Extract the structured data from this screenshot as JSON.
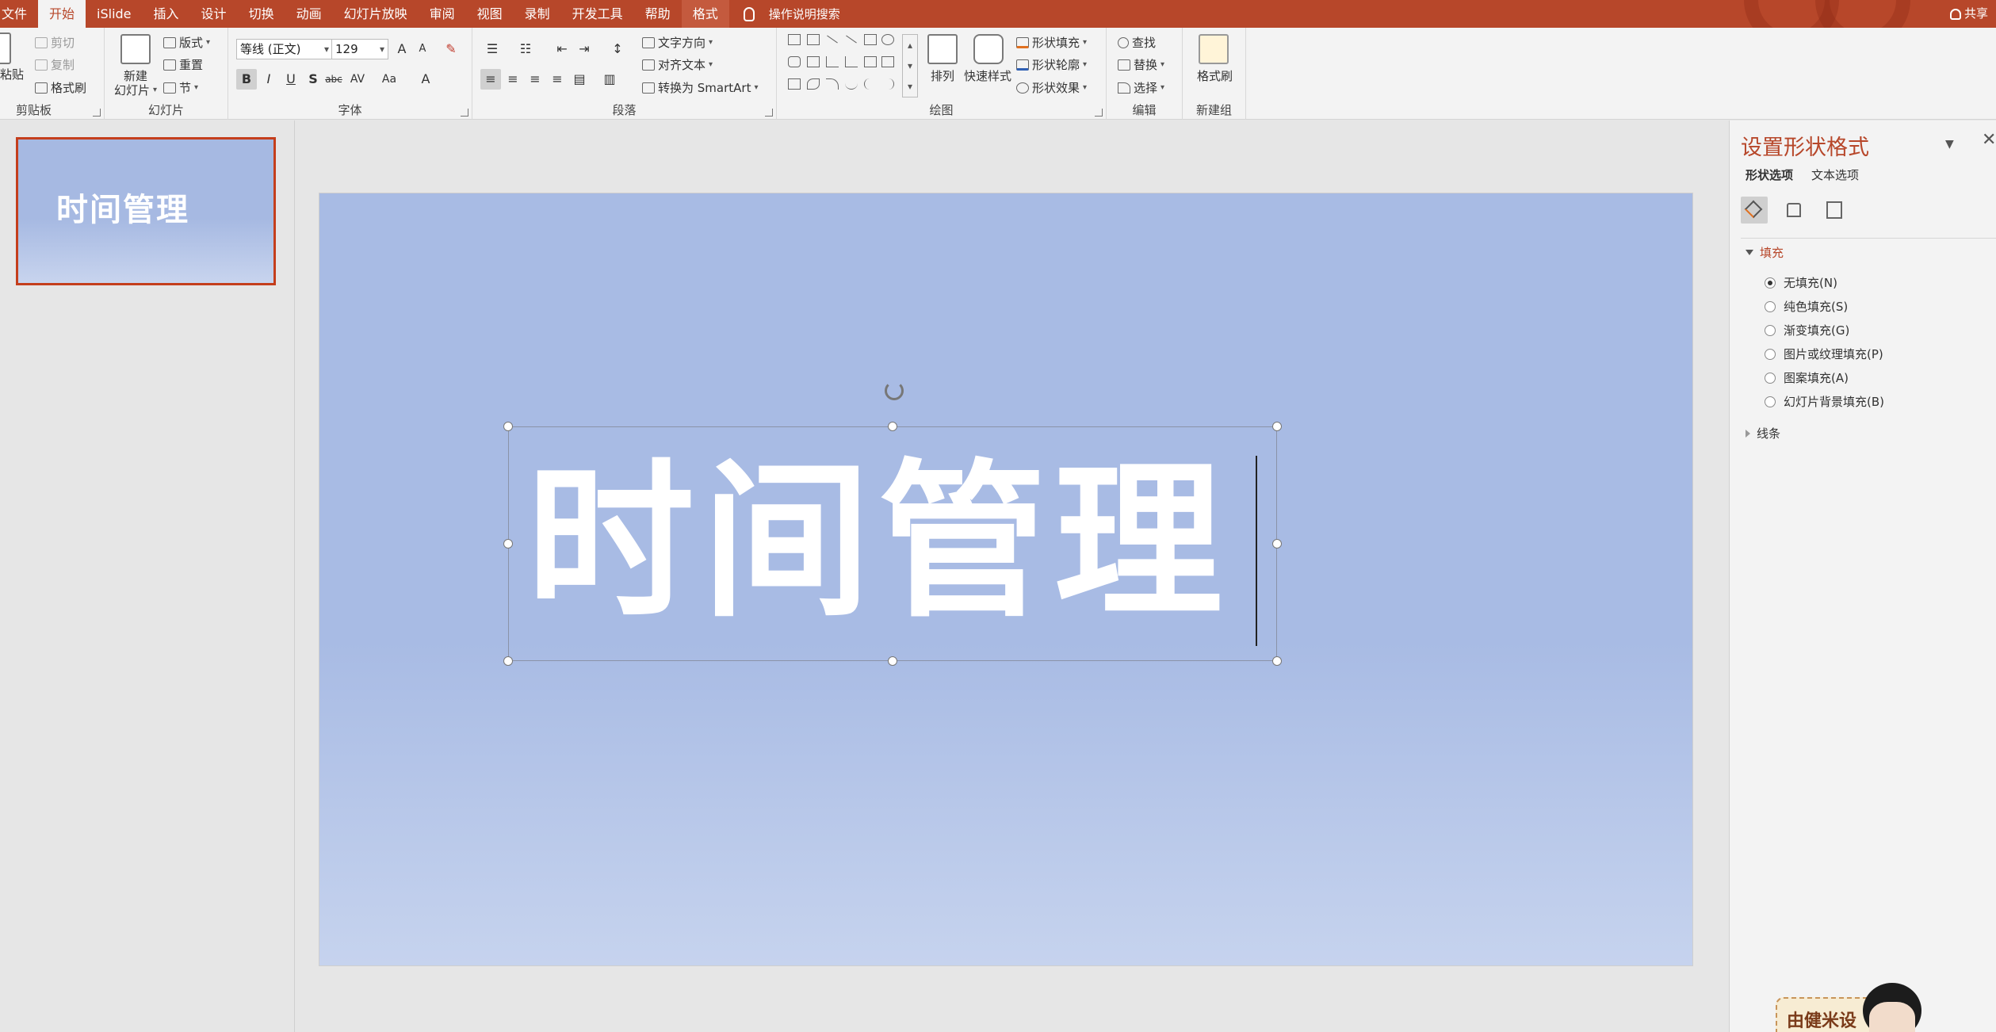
{
  "tabs": [
    "文件",
    "开始",
    "iSlide",
    "插入",
    "设计",
    "切换",
    "动画",
    "幻灯片放映",
    "审阅",
    "视图",
    "录制",
    "开发工具",
    "帮助",
    "格式"
  ],
  "active_tab": "开始",
  "search_label": "操作说明搜索",
  "share_label": "共享",
  "ribbon": {
    "clipboard": {
      "paste": "粘贴",
      "cut": "剪切",
      "copy": "复制",
      "format_painter": "格式刷",
      "label": "剪贴板"
    },
    "slides": {
      "new_slide_line1": "新建",
      "new_slide_line2": "幻灯片",
      "layout": "版式",
      "reset": "重置",
      "section": "节",
      "label": "幻灯片"
    },
    "font": {
      "font_name": "等线 (正文)",
      "font_size": "129",
      "bold": "B",
      "italic": "I",
      "underline": "U",
      "shadow": "S",
      "strike": "abc",
      "spacing": "AV",
      "case": "Aa",
      "color": "A",
      "grow": "A",
      "shrink": "A",
      "label": "字体"
    },
    "paragraph": {
      "text_direction": "文字方向",
      "align_text": "对齐文本",
      "smartart": "转换为 SmartArt",
      "label": "段落"
    },
    "drawing": {
      "arrange": "排列",
      "quick_styles": "快速样式",
      "shape_fill": "形状填充",
      "shape_outline": "形状轮廓",
      "shape_effects": "形状效果",
      "label": "绘图"
    },
    "editing": {
      "find": "查找",
      "replace": "替换",
      "select": "选择",
      "label": "编辑"
    },
    "newgroup": {
      "format_painter": "格式刷",
      "label": "新建组"
    }
  },
  "thumbnail": {
    "title": "时间管理"
  },
  "slide": {
    "title": "时间管理"
  },
  "format_pane": {
    "title": "设置形状格式",
    "tab_shape": "形状选项",
    "tab_text": "文本选项",
    "fill_section": "填充",
    "fill_options": [
      "无填充(N)",
      "纯色填充(S)",
      "渐变填充(G)",
      "图片或纹理填充(P)",
      "图案填充(A)",
      "幻灯片背景填充(B)"
    ],
    "selected_fill": "无填充(N)",
    "line_section": "线条"
  },
  "mascot_text": "由健米设"
}
